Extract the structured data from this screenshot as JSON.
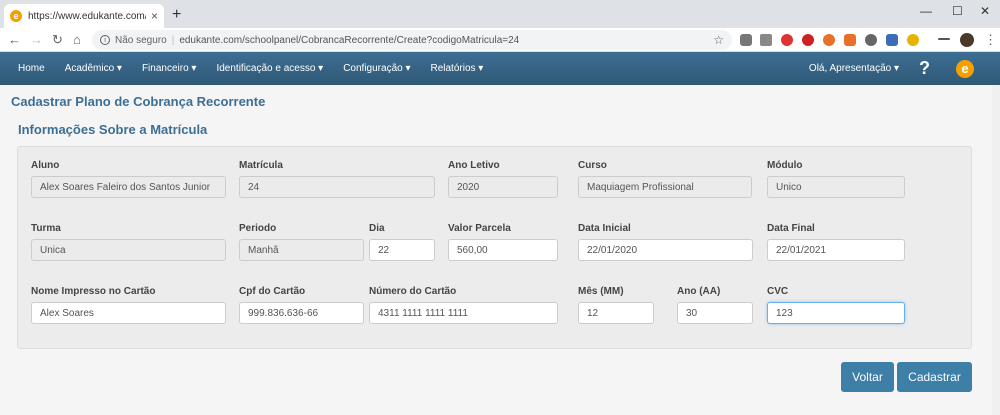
{
  "browser": {
    "tab_title": "https://www.edukante.com/scho",
    "insecure_label": "Não seguro",
    "separator": "|",
    "url": "edukante.com/schoolpanel/CobrancaRecorrente/Create?codigoMatricula=24"
  },
  "navbar": {
    "items": [
      "Home",
      "Acadêmico ▾",
      "Financeiro ▾",
      "Identificação e acesso ▾",
      "Configuração ▾",
      "Relatórios ▾"
    ],
    "user_greeting": "Olá, Apresentação ▾",
    "help": "?",
    "logo": "e"
  },
  "page": {
    "title": "Cadastrar Plano de Cobrança Recorrente",
    "section_title": "Informações Sobre a Matrícula"
  },
  "form": {
    "aluno": {
      "label": "Aluno",
      "value": "Alex Soares Faleiro dos Santos Junior"
    },
    "matricula": {
      "label": "Matrícula",
      "value": "24"
    },
    "ano_letivo": {
      "label": "Ano Letivo",
      "value": "2020"
    },
    "curso": {
      "label": "Curso",
      "value": "Maquiagem Profissional"
    },
    "modulo": {
      "label": "Módulo",
      "value": "Unico"
    },
    "turma": {
      "label": "Turma",
      "value": "Unica"
    },
    "periodo": {
      "label": "Periodo",
      "value": "Manhã"
    },
    "dia": {
      "label": "Dia",
      "value": "22"
    },
    "valor_parcela": {
      "label": "Valor Parcela",
      "value": "560,00"
    },
    "data_inicial": {
      "label": "Data Inicial",
      "value": "22/01/2020"
    },
    "data_final": {
      "label": "Data Final",
      "value": "22/01/2021"
    },
    "nome_cartao": {
      "label": "Nome Impresso no Cartão",
      "value": "Alex Soares"
    },
    "cpf_cartao": {
      "label": "Cpf do Cartão",
      "value": "999.836.636-66"
    },
    "numero_cartao": {
      "label": "Número do Cartão",
      "value": "4311 1111 1111 1111"
    },
    "mes": {
      "label": "Mês (MM)",
      "value": "12"
    },
    "ano": {
      "label": "Ano (AA)",
      "value": "30"
    },
    "cvc": {
      "label": "CVC",
      "value": "123"
    }
  },
  "buttons": {
    "voltar": "Voltar",
    "cadastrar": "Cadastrar"
  },
  "colors": {
    "navbar": "#2f5876",
    "title": "#3d6e93",
    "button": "#3d7fa6",
    "logo": "#f5a000"
  }
}
